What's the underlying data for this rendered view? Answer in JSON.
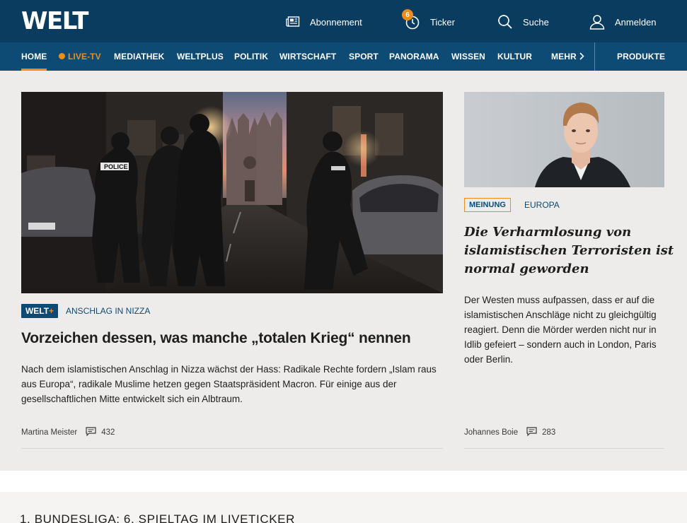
{
  "header": {
    "logo": "WELT",
    "tools": {
      "abonnement": "Abonnement",
      "ticker": "Ticker",
      "ticker_count": "6",
      "suche": "Suche",
      "anmelden": "Anmelden"
    }
  },
  "nav": {
    "items": [
      {
        "label": "HOME"
      },
      {
        "label": "LIVE-TV"
      },
      {
        "label": "MEDIATHEK"
      },
      {
        "label": "WELTPLUS"
      },
      {
        "label": "POLITIK"
      },
      {
        "label": "WIRTSCHAFT"
      },
      {
        "label": "SPORT"
      },
      {
        "label": "PANORAMA"
      },
      {
        "label": "WISSEN"
      },
      {
        "label": "KULTUR"
      },
      {
        "label": "MEHR"
      }
    ],
    "produkte": "PRODUKTE"
  },
  "lead_article": {
    "badge": "WELT",
    "badge_plus": "+",
    "kicker": "ANSCHLAG IN NIZZA",
    "headline": "Vorzeichen dessen, was manche „totalen Krieg“ nennen",
    "teaser": "Nach dem islamistischen Anschlag in Nizza wächst der Hass: Radikale Rechte fordern „Islam raus aus Europa“, radikale Muslime hetzen gegen Staatspräsident Macron. Für einige aus der gesellschaftlichen Mitte entwickelt sich ein Albtraum.",
    "author": "Martina Meister",
    "comments": "432",
    "image_text": "POLICE"
  },
  "side_article": {
    "badge": "MEINUNG",
    "kicker": "EUROPA",
    "headline": "Die Verharmlosung von islamistischen Terroristen ist normal geworden",
    "teaser": "Der Westen muss aufpassen, dass er auf die islamistischen Anschläge nicht zu gleichgültig reagiert. Denn die Mörder werden nicht nur in Idlib gefeiert – sondern auch in London, Paris oder Berlin.",
    "author": "Johannes Boie",
    "comments": "283"
  },
  "section": {
    "title": "1. BUNDESLIGA: 6. SPIELTAG IM LIVETICKER"
  },
  "colors": {
    "header_bg": "#0a3c5f",
    "nav_bg": "#0d4a74",
    "accent": "#f18c16",
    "content_bg": "#edecea"
  }
}
